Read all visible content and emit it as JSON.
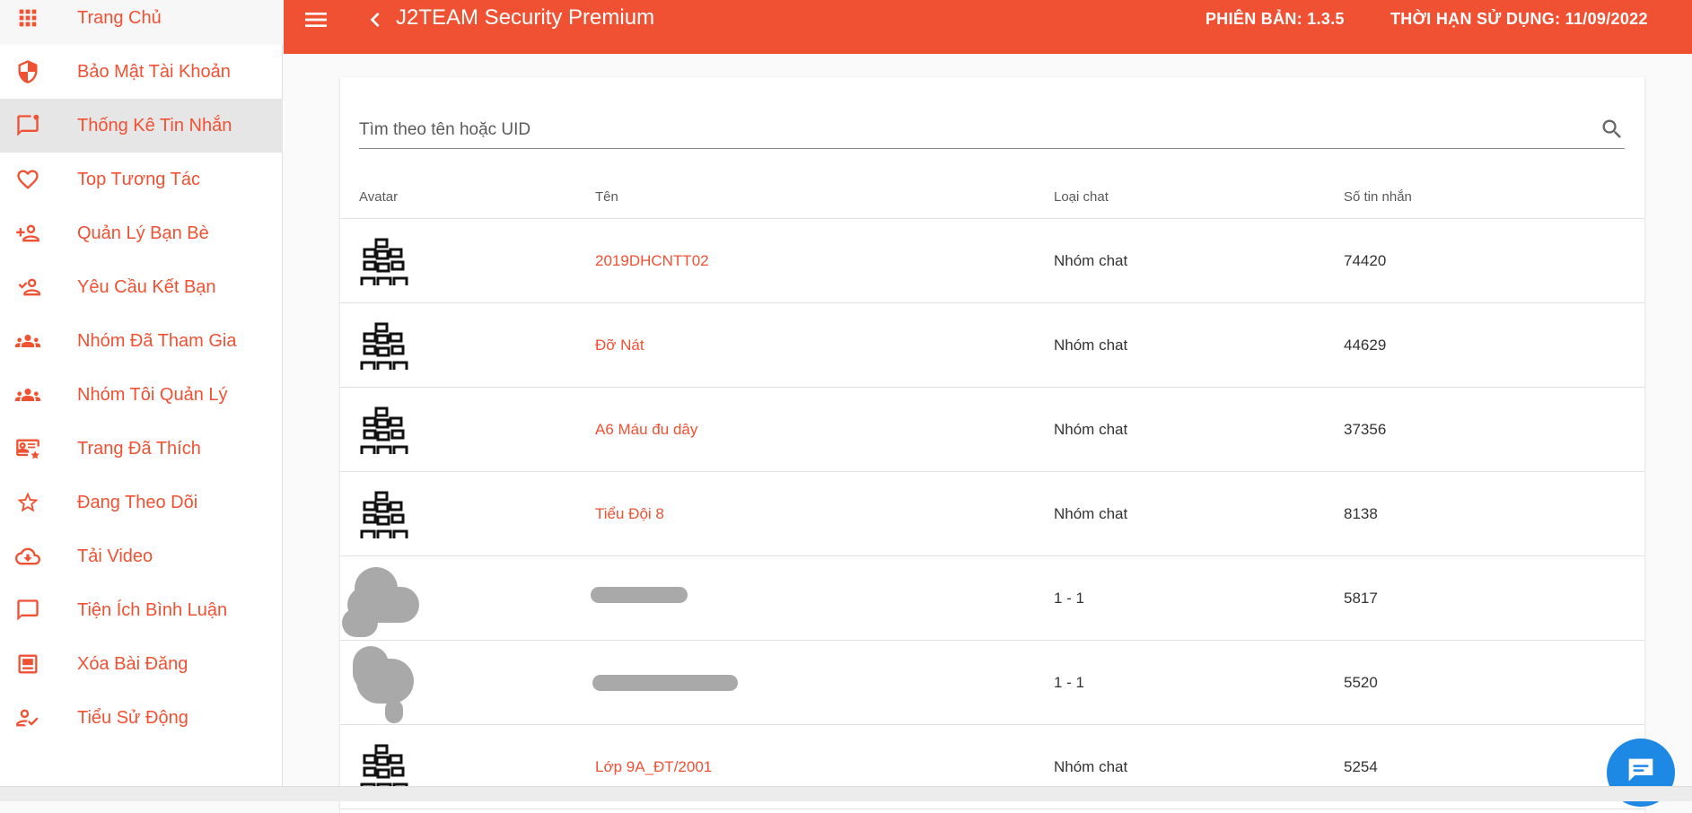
{
  "sidebar": {
    "items": [
      {
        "label": "Trang Chủ",
        "icon": "apps-grid-icon"
      },
      {
        "label": "Bảo Mật Tài Khoản",
        "icon": "shield-icon"
      },
      {
        "label": "Thống Kê Tin Nhắn",
        "icon": "message-notification-icon"
      },
      {
        "label": "Top Tương Tác",
        "icon": "heart-icon"
      },
      {
        "label": "Quản Lý Bạn Bè",
        "icon": "person-add-icon"
      },
      {
        "label": "Yêu Cầu Kết Bạn",
        "icon": "person-check-icon"
      },
      {
        "label": "Nhóm Đã Tham Gia",
        "icon": "group-icon"
      },
      {
        "label": "Nhóm Tôi Quản Lý",
        "icon": "group-manage-icon"
      },
      {
        "label": "Trang Đã Thích",
        "icon": "page-star-icon"
      },
      {
        "label": "Đang Theo Dõi",
        "icon": "star-icon"
      },
      {
        "label": "Tải Video",
        "icon": "cloud-download-icon"
      },
      {
        "label": "Tiện Ích Bình Luận",
        "icon": "comment-icon"
      },
      {
        "label": "Xóa Bài Đăng",
        "icon": "post-delete-icon"
      },
      {
        "label": "Tiểu Sử Động",
        "icon": "person-edit-icon"
      }
    ],
    "active_index": 2
  },
  "header": {
    "title": "J2TEAM Security Premium",
    "version": "PHIÊN BẢN: 1.3.5",
    "expiry": "THỜI HẠN SỬ DỤNG: 11/09/2022"
  },
  "search": {
    "placeholder": "Tìm theo tên hoặc UID"
  },
  "table": {
    "columns": [
      "Avatar",
      "Tên",
      "Loại chat",
      "Số tin nhắn"
    ],
    "rows": [
      {
        "name": "2019DHCNTT02",
        "type": "Nhóm chat",
        "count": "74420",
        "avatar": "group-chat-icon"
      },
      {
        "name": "Đỡ Nát",
        "type": "Nhóm chat",
        "count": "44629",
        "avatar": "group-chat-icon"
      },
      {
        "name": "A6 Máu đu dây",
        "type": "Nhóm chat",
        "count": "37356",
        "avatar": "group-chat-icon"
      },
      {
        "name": "Tiểu Đội 8",
        "type": "Nhóm chat",
        "count": "8138",
        "avatar": "group-chat-icon"
      },
      {
        "name": "",
        "type": "1 - 1",
        "count": "5817",
        "avatar": "redacted-avatar"
      },
      {
        "name": "",
        "type": "1 - 1",
        "count": "5520",
        "avatar": "redacted-avatar"
      },
      {
        "name": "Lớp 9A_ĐT/2001",
        "type": "Nhóm chat",
        "count": "5254",
        "avatar": "group-chat-icon"
      }
    ]
  },
  "colors": {
    "accent": "#f05133",
    "active_bg": "#e6e6e6",
    "fab": "#1e88e5"
  }
}
